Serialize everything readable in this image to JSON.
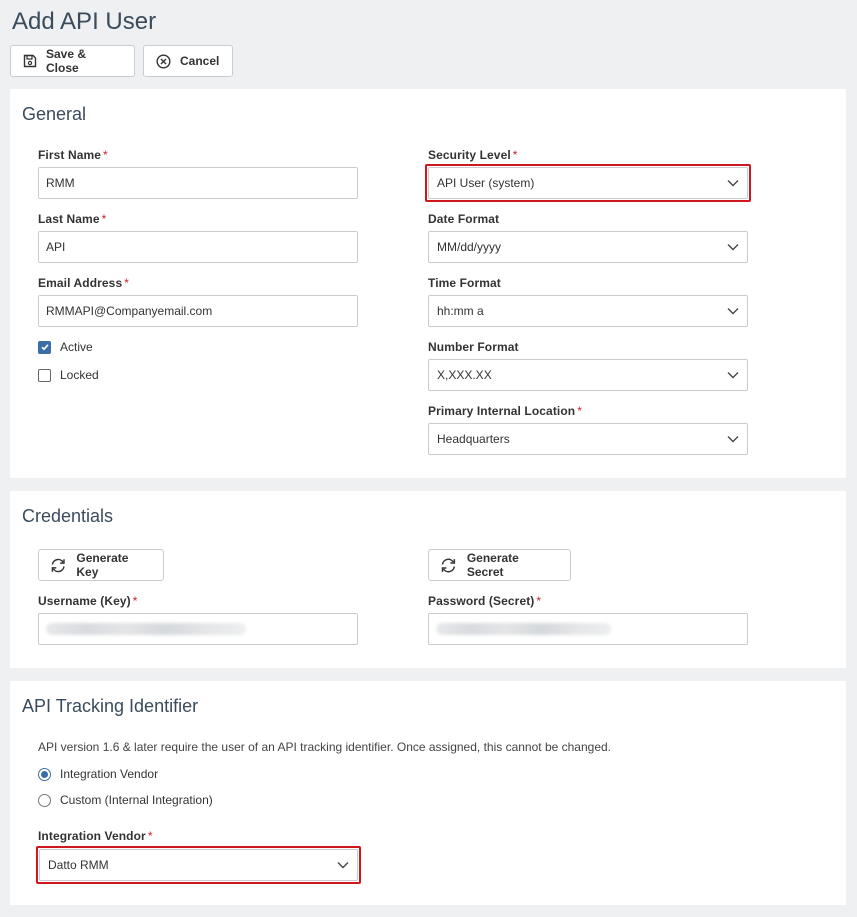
{
  "page": {
    "title": "Add API User"
  },
  "toolbar": {
    "save_label": "Save & Close",
    "cancel_label": "Cancel"
  },
  "general": {
    "title": "General",
    "first_name": {
      "label": "First Name",
      "value": "RMM"
    },
    "last_name": {
      "label": "Last Name",
      "value": "API"
    },
    "email": {
      "label": "Email Address",
      "value": "RMMAPI@Companyemail.com"
    },
    "active": {
      "label": "Active",
      "checked": true
    },
    "locked": {
      "label": "Locked",
      "checked": false
    },
    "security_level": {
      "label": "Security Level",
      "value": "API User (system)"
    },
    "date_format": {
      "label": "Date Format",
      "value": "MM/dd/yyyy"
    },
    "time_format": {
      "label": "Time Format",
      "value": "hh:mm a"
    },
    "number_format": {
      "label": "Number Format",
      "value": "X,XXX.XX"
    },
    "primary_location": {
      "label": "Primary Internal Location",
      "value": "Headquarters"
    }
  },
  "credentials": {
    "title": "Credentials",
    "generate_key_label": "Generate Key",
    "generate_secret_label": "Generate Secret",
    "username": {
      "label": "Username (Key)"
    },
    "password": {
      "label": "Password (Secret)"
    }
  },
  "tracking": {
    "title": "API Tracking Identifier",
    "note": "API version 1.6 & later require the user of an API tracking identifier. Once assigned, this cannot be changed.",
    "option_vendor": {
      "label": "Integration Vendor",
      "selected": true
    },
    "option_custom": {
      "label": "Custom (Internal Integration)",
      "selected": false
    },
    "vendor_field": {
      "label": "Integration Vendor",
      "value": "Datto RMM"
    }
  },
  "required_marker": "*",
  "colors": {
    "accent": "#3a6ea5",
    "highlight": "#d0161e",
    "required": "#c8202c",
    "title": "#3a4b5c"
  },
  "icons": {
    "save": "floppy-disk-icon",
    "cancel": "circle-x-icon",
    "refresh": "refresh-icon",
    "chevron": "chevron-down-icon",
    "check": "check-icon"
  }
}
